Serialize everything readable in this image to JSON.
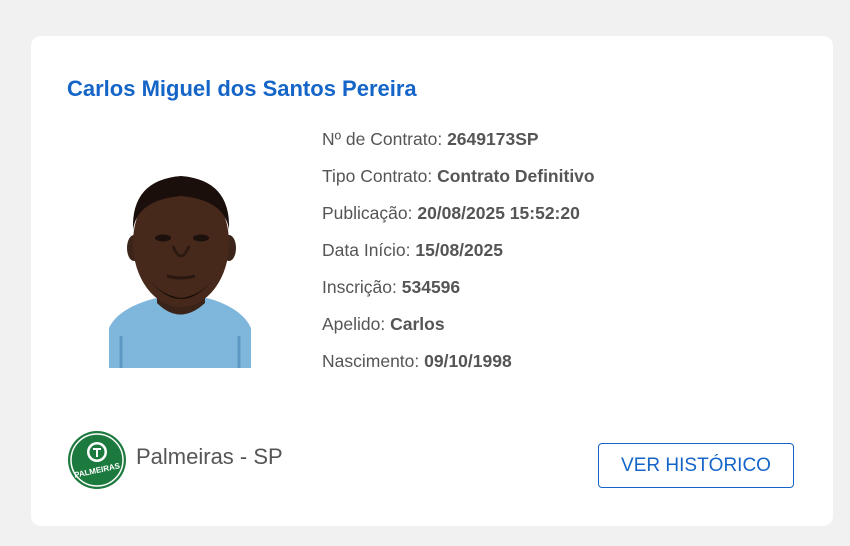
{
  "player": {
    "name": "Carlos Miguel dos Santos Pereira"
  },
  "details": [
    {
      "label": "Nº de Contrato: ",
      "value": "2649173SP"
    },
    {
      "label": "Tipo Contrato: ",
      "value": "Contrato Definitivo"
    },
    {
      "label": "Publicação: ",
      "value": "20/08/2025 15:52:20"
    },
    {
      "label": "Data Início: ",
      "value": "15/08/2025"
    },
    {
      "label": "Inscrição: ",
      "value": "534596"
    },
    {
      "label": "Apelido: ",
      "value": "Carlos"
    },
    {
      "label": "Nascimento: ",
      "value": "09/10/1998"
    }
  ],
  "club": {
    "name": "Palmeiras - SP",
    "logo_text": "PALMEIRAS",
    "logo_icon": "palmeiras-crest-icon"
  },
  "actions": {
    "history_label": "VER HISTÓRICO"
  },
  "colors": {
    "accent": "#1565c8",
    "text": "#555555",
    "background": "#f1f1f1",
    "card": "#ffffff",
    "club_green": "#1d7a3e"
  }
}
